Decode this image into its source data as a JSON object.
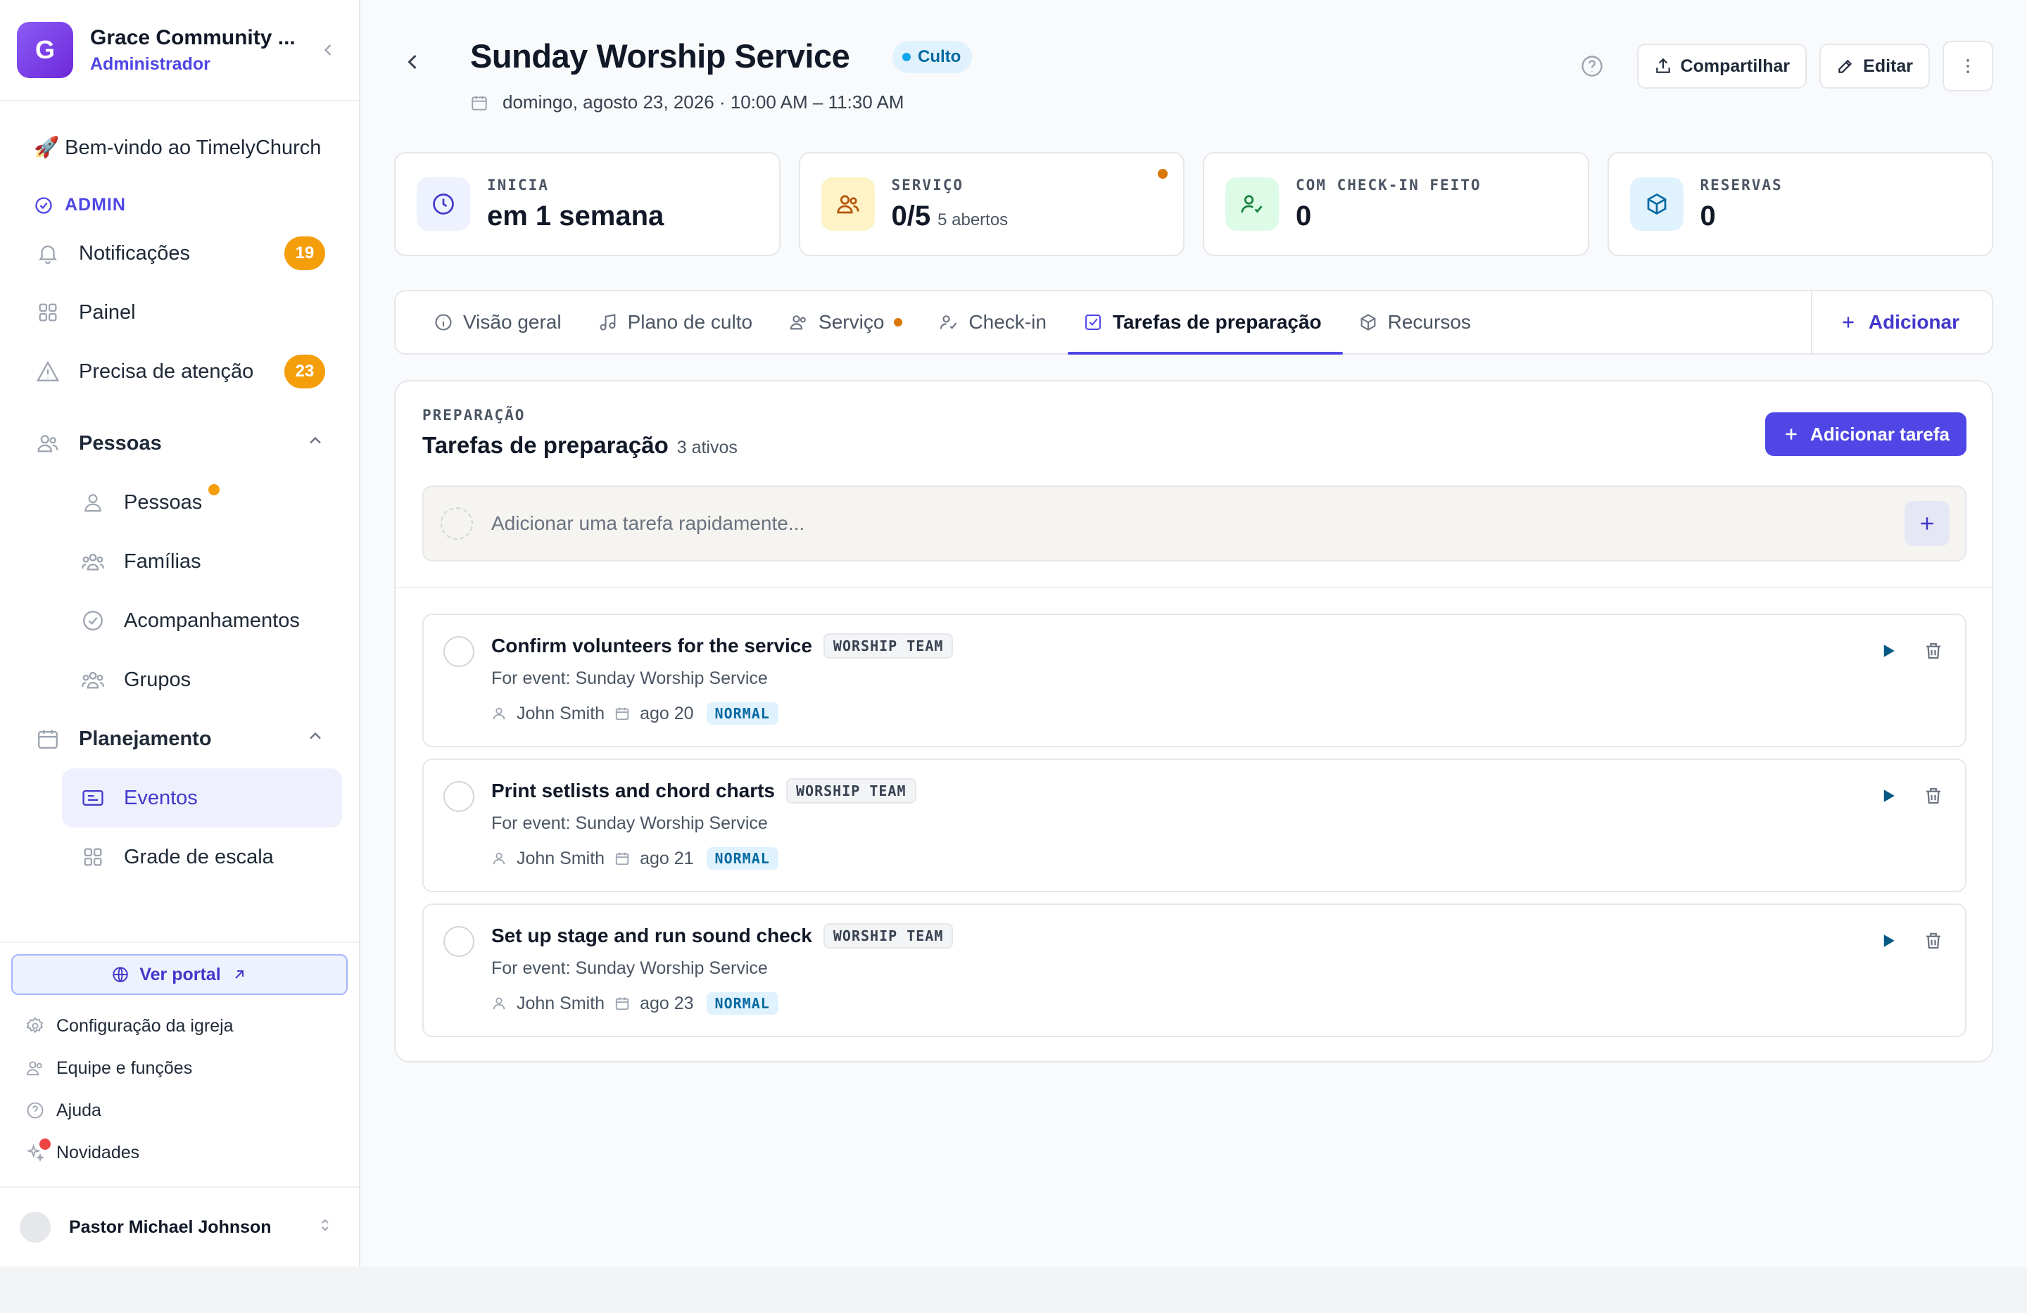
{
  "org": {
    "avatar_letter": "G",
    "name": "Grace Community ...",
    "role": "Administrador"
  },
  "sidebar": {
    "welcome_emoji": "🚀",
    "welcome": "Bem-vindo ao TimelyChurch",
    "admin_label": "ADMIN",
    "top_items": [
      {
        "label": "Notificações",
        "badge": "19",
        "icon": "bell-icon"
      },
      {
        "label": "Painel",
        "icon": "dashboard-icon"
      },
      {
        "label": "Precisa de atenção",
        "badge": "23",
        "icon": "alert-triangle-icon"
      }
    ],
    "people_section": "Pessoas",
    "people_items": [
      "Pessoas",
      "Famílias",
      "Acompanhamentos",
      "Grupos"
    ],
    "planning_section": "Planejamento",
    "planning_items": [
      "Eventos",
      "Grade de escala"
    ],
    "portal_button": "Ver portal",
    "footer_links": [
      "Configuração da igreja",
      "Equipe e funções",
      "Ajuda",
      "Novidades"
    ],
    "user_name": "Pastor Michael Johnson"
  },
  "event": {
    "title": "Sunday Worship Service",
    "type_badge": "Culto",
    "datetime": "domingo, agosto 23, 2026 · 10:00 AM – 11:30 AM",
    "share_label": "Compartilhar",
    "edit_label": "Editar"
  },
  "stats": [
    {
      "label": "INICIA",
      "value": "em 1 semana",
      "sub": ""
    },
    {
      "label": "SERVIÇO",
      "value": "0/5",
      "sub": "5 abertos"
    },
    {
      "label": "COM CHECK-IN FEITO",
      "value": "0",
      "sub": ""
    },
    {
      "label": "RESERVAS",
      "value": "0",
      "sub": ""
    }
  ],
  "tabs": [
    "Visão geral",
    "Plano de culto",
    "Serviço",
    "Check-in",
    "Tarefas de preparação",
    "Recursos"
  ],
  "tabs_add": "Adicionar",
  "panel": {
    "eyebrow": "PREPARAÇÃO",
    "title": "Tarefas de preparação",
    "count": "3 ativos",
    "add_button": "Adicionar tarefa",
    "quick_placeholder": "Adicionar uma tarefa rapidamente..."
  },
  "tasks": [
    {
      "title": "Confirm volunteers for the service",
      "team": "WORSHIP TEAM",
      "event": "For event: Sunday Worship Service",
      "assignee": "John Smith",
      "date": "ago 20",
      "priority": "NORMAL"
    },
    {
      "title": "Print setlists and chord charts",
      "team": "WORSHIP TEAM",
      "event": "For event: Sunday Worship Service",
      "assignee": "John Smith",
      "date": "ago 21",
      "priority": "NORMAL"
    },
    {
      "title": "Set up stage and run sound check",
      "team": "WORSHIP TEAM",
      "event": "For event: Sunday Worship Service",
      "assignee": "John Smith",
      "date": "ago 23",
      "priority": "NORMAL"
    }
  ],
  "colors": {
    "accent": "#4f46e5",
    "badge": "#f59e0b",
    "status_dot": "#d97706"
  }
}
